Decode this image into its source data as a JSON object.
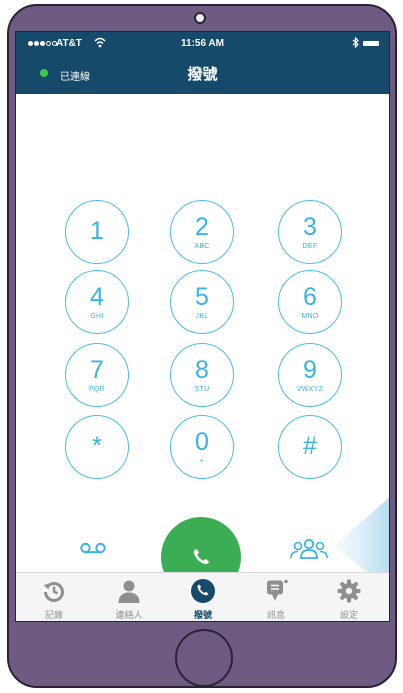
{
  "status_bar": {
    "carrier": "AT&T",
    "time": "11:56 AM"
  },
  "header": {
    "status_label": "已連線",
    "title": "撥號"
  },
  "keypad": {
    "keys": [
      {
        "digit": "1",
        "letters": ""
      },
      {
        "digit": "2",
        "letters": "ABC"
      },
      {
        "digit": "3",
        "letters": "DEF"
      },
      {
        "digit": "4",
        "letters": "GHI"
      },
      {
        "digit": "5",
        "letters": "JKL"
      },
      {
        "digit": "6",
        "letters": "MNO"
      },
      {
        "digit": "7",
        "letters": "PQR"
      },
      {
        "digit": "8",
        "letters": "STU"
      },
      {
        "digit": "9",
        "letters": "VWXYZ"
      },
      {
        "digit": "*",
        "letters": ""
      },
      {
        "digit": "0",
        "letters": "+"
      },
      {
        "digit": "#",
        "letters": ""
      }
    ]
  },
  "bottom_actions": {
    "left_icon": "voicemail-icon",
    "center_icon": "phone-icon",
    "right_icon": "group-icon"
  },
  "tab_bar": {
    "tabs": [
      {
        "label": "記錄",
        "icon": "history-icon",
        "active": false
      },
      {
        "label": "連絡人",
        "icon": "contact-icon",
        "active": false
      },
      {
        "label": "撥號",
        "icon": "phone-icon",
        "active": true
      },
      {
        "label": "訊息",
        "icon": "message-icon",
        "active": false
      },
      {
        "label": "設定",
        "icon": "gear-icon",
        "active": false
      }
    ]
  },
  "colors": {
    "phone_frame": "#6e5b82",
    "header": "#154a6b",
    "key_accent": "#4bbde9",
    "call_button": "#3aad55",
    "online_indicator": "#3cc84e",
    "active_tab": "#154a6b",
    "inactive_tab": "#8f8f8f"
  }
}
